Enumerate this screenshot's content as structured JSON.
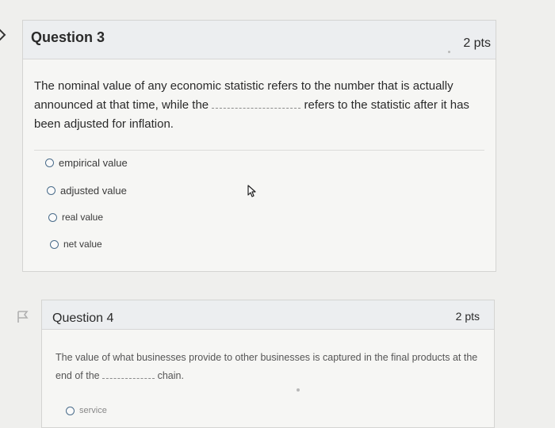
{
  "questions": [
    {
      "title": "Question 3",
      "points": "2 pts",
      "text_part1": "The nominal value of any economic statistic refers to the number that is actually announced at that time, while the",
      "text_part2": "refers to the statistic after it has been adjusted for inflation.",
      "options": [
        "empirical value",
        "adjusted value",
        "real value",
        "net value"
      ]
    },
    {
      "title": "Question 4",
      "points": "2 pts",
      "text_part1": "The value of what businesses provide to other businesses is captured in the final products at the end of the",
      "text_part2": "chain.",
      "options": [
        "service"
      ]
    }
  ],
  "colors": {
    "background": "#efefed",
    "card": "#f6f6f4",
    "header": "#eceef0",
    "radio": "#4a6c8a"
  },
  "icons": [
    "chevron-right-icon",
    "cursor-icon",
    "flag-icon"
  ]
}
